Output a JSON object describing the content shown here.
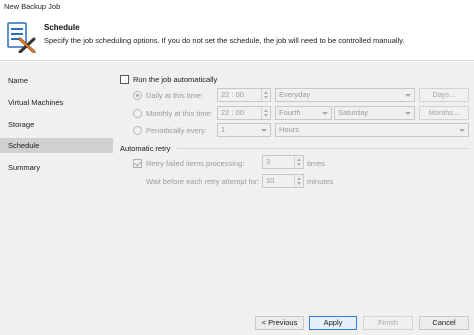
{
  "window": {
    "title": "New Backup Job"
  },
  "header": {
    "title": "Schedule",
    "description": "Specify the job scheduling options. If you do not set the schedule, the job will need to be controlled manually."
  },
  "sidebar": {
    "items": [
      {
        "label": "Name",
        "active": false
      },
      {
        "label": "Virtual Machines",
        "active": false
      },
      {
        "label": "Storage",
        "active": false
      },
      {
        "label": "Schedule",
        "active": true
      },
      {
        "label": "Summary",
        "active": false
      }
    ]
  },
  "schedule": {
    "run_auto_label": "Run the job automatically",
    "run_auto_checked": false,
    "daily": {
      "label": "Daily at this time:",
      "selected": true,
      "time": "22 : 00",
      "period": "Everyday",
      "button": "Days..."
    },
    "monthly": {
      "label": "Monthly at this time:",
      "selected": false,
      "time": "22 : 00",
      "week": "Fourth",
      "day": "Saturday",
      "button": "Months..."
    },
    "periodic": {
      "label": "Periodically every:",
      "selected": false,
      "value": "1",
      "unit": "Hours"
    }
  },
  "retry": {
    "group_title": "Automatic retry",
    "retry_label": "Retry failed items processing:",
    "retry_checked": true,
    "retry_count": "3",
    "retry_unit": "times",
    "wait_label": "Wait before each retry attempt for:",
    "wait_value": "10",
    "wait_unit": "minutes"
  },
  "footer": {
    "previous": "< Previous",
    "apply": "Apply",
    "finish": "Finish",
    "cancel": "Cancel"
  },
  "colors": {
    "accent": "#2d7dd2",
    "selected_nav": "#d0d0d0",
    "panel": "#f0f0f0"
  },
  "icons": {
    "logo": "backup-job-logo-icon"
  }
}
